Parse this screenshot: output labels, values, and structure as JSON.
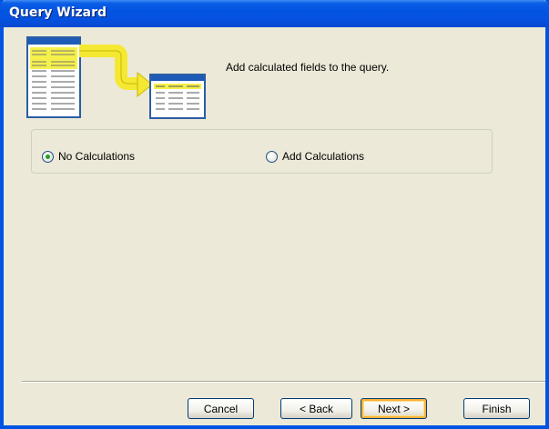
{
  "window": {
    "title": "Query Wizard"
  },
  "header": {
    "description": "Add calculated fields to the query.",
    "icon": "query-wizard-illustration"
  },
  "options": {
    "no_calculations": {
      "label": "No Calculations",
      "checked": true
    },
    "add_calculations": {
      "label": "Add Calculations",
      "checked": false
    }
  },
  "buttons": {
    "cancel": "Cancel",
    "back": "< Back",
    "next": "Next >",
    "finish": "Finish"
  },
  "colors": {
    "titlebar": "#0454e2",
    "dialog_bg": "#ece9d8",
    "radio_dot": "#21a121",
    "default_button_glow": "#f8b33c"
  }
}
